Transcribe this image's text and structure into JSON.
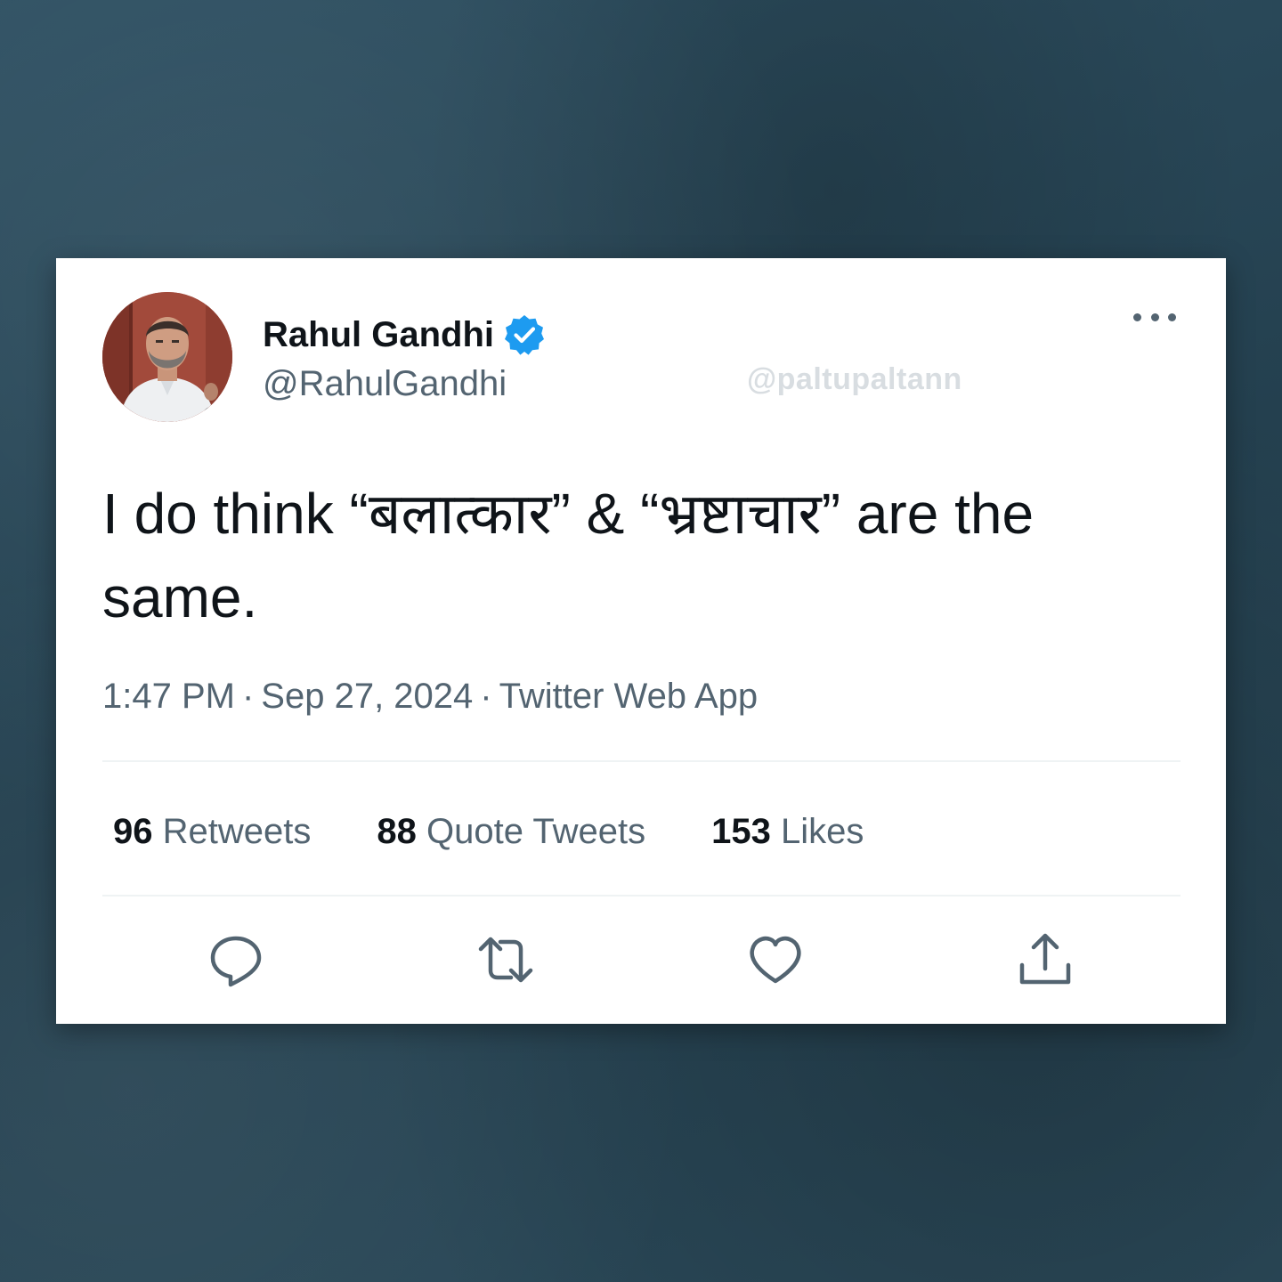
{
  "tweet": {
    "author": {
      "display_name": "Rahul Gandhi",
      "handle": "@RahulGandhi",
      "verified": true
    },
    "watermark": "@paltupaltann",
    "text": "I do think “बलात्कार” & “भ्रष्टाचार” are the same.",
    "meta": {
      "time": "1:47 PM",
      "date": "Sep 27, 2024",
      "source": "Twitter Web App",
      "separator": "·"
    },
    "stats": {
      "retweets": {
        "count": "96",
        "label": "Retweets"
      },
      "quote_tweets": {
        "count": "88",
        "label": "Quote Tweets"
      },
      "likes": {
        "count": "153",
        "label": "Likes"
      }
    },
    "actions": [
      "reply-icon",
      "retweet-icon",
      "like-icon",
      "share-icon"
    ]
  },
  "colors": {
    "background": "#2a4a5a",
    "card": "#ffffff",
    "text_primary": "#0f1419",
    "text_secondary": "#536471",
    "verified_blue": "#1d9bf0",
    "divider": "#eff3f4"
  }
}
